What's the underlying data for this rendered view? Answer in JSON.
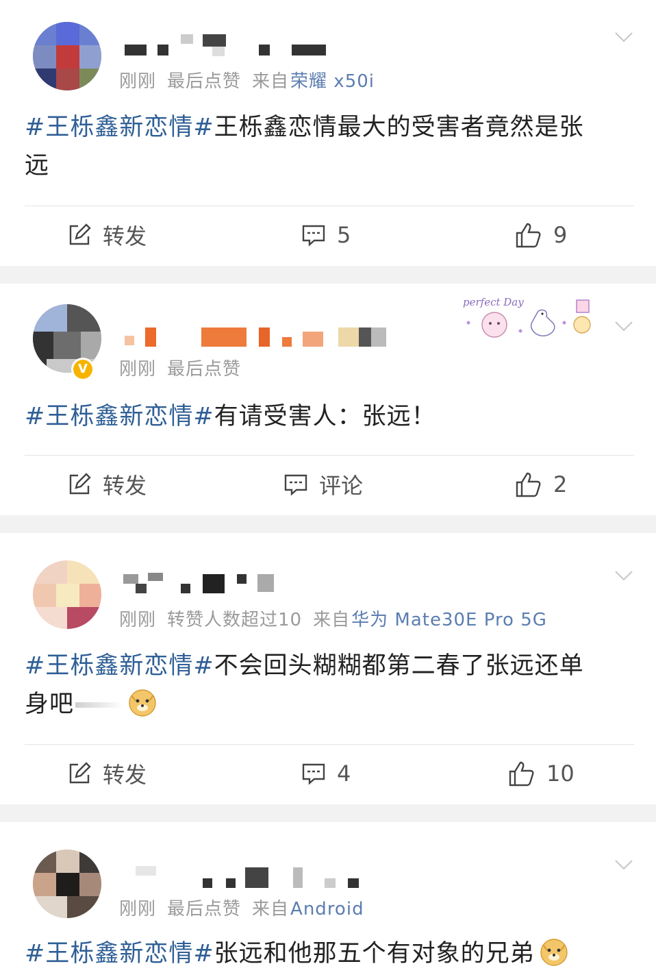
{
  "posts": [
    {
      "meta": {
        "time": "刚刚",
        "status": "最后点赞",
        "source_prefix": "来自",
        "device": "荣耀 x50i"
      },
      "tag": "#王栎鑫新恋情#",
      "text": "王栎鑫恋情最大的受害者竟然是张远",
      "actions": {
        "repost": "转发",
        "comment": "5",
        "like": "9"
      }
    },
    {
      "meta": {
        "time": "刚刚",
        "status": "最后点赞",
        "source_prefix": "",
        "device": ""
      },
      "tag": "#王栎鑫新恋情#",
      "text": "有请受害人：张远！",
      "actions": {
        "repost": "转发",
        "comment": "评论",
        "like": "2"
      },
      "sticker_text": "perfect Day"
    },
    {
      "meta": {
        "time": "刚刚",
        "status": "转赞人数超过10",
        "source_prefix": "来自",
        "device": "华为 Mate30E Pro 5G"
      },
      "tag": "#王栎鑫新恋情#",
      "text": "不会回头糊糊都第二春了张远还单身吧",
      "actions": {
        "repost": "转发",
        "comment": "4",
        "like": "10"
      }
    },
    {
      "meta": {
        "time": "刚刚",
        "status": "最后点赞",
        "source_prefix": "来自",
        "device": "Android"
      },
      "tag": "#王栎鑫新恋情#",
      "text": "张远和他那五个有对象的兄弟"
    }
  ],
  "icons": {
    "repost": "share-edit-icon",
    "comment": "comment-bubble-icon",
    "like": "thumbs-up-icon",
    "menu": "chevron-down-icon",
    "emoji": "doge-emoji-icon",
    "verified": "verified-badge-icon"
  },
  "colors": {
    "hashtag": "#2f5f95",
    "device": "#5b7db0",
    "meta": "#9a9a9a",
    "text": "#222222",
    "badge": "#f6b400"
  }
}
